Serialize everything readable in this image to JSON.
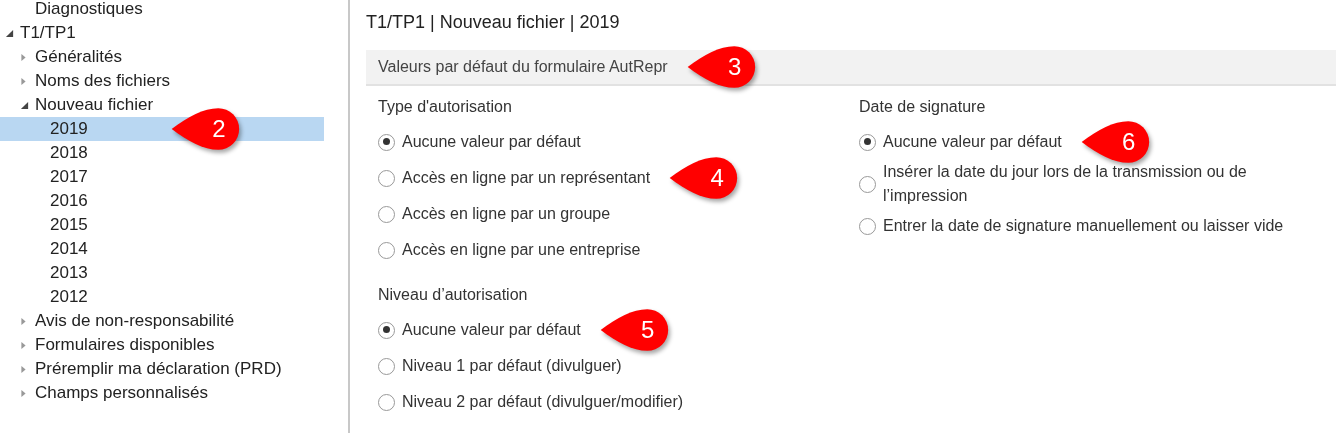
{
  "tree": {
    "clipped_above": [
      {
        "label": "Diagnostiques",
        "selected": false
      }
    ],
    "items": [
      {
        "label": "T1/TP1",
        "expanded": true,
        "selected": false,
        "children": [
          {
            "label": "Généralités",
            "expanded": false,
            "selected": false
          },
          {
            "label": "Noms des fichiers",
            "expanded": false,
            "selected": false
          },
          {
            "label": "Nouveau fichier",
            "expanded": true,
            "selected": false,
            "children": [
              {
                "label": "2019",
                "selected": true,
                "callout": "2"
              },
              {
                "label": "2018",
                "selected": false
              },
              {
                "label": "2017",
                "selected": false
              },
              {
                "label": "2016",
                "selected": false
              },
              {
                "label": "2015",
                "selected": false
              },
              {
                "label": "2014",
                "selected": false
              },
              {
                "label": "2013",
                "selected": false
              },
              {
                "label": "2012",
                "selected": false
              }
            ]
          },
          {
            "label": "Avis de non-responsabilité",
            "expanded": false,
            "selected": false
          },
          {
            "label": "Formulaires disponibles",
            "expanded": false,
            "selected": false
          },
          {
            "label": "Préremplir ma déclaration (PRD)",
            "expanded": false,
            "selected": false
          },
          {
            "label": "Champs personnalisés",
            "expanded": false,
            "selected": false
          }
        ]
      }
    ]
  },
  "page": {
    "breadcrumb": "T1/TP1 | Nouveau fichier | 2019",
    "section": {
      "title": "Valeurs par défaut du formulaire AutRepr",
      "callout": "3"
    },
    "columns": [
      [
        {
          "title": "Type d'autorisation",
          "options": [
            {
              "label": "Aucune valeur par défaut",
              "selected": true
            },
            {
              "label": "Accès en ligne par un représentant",
              "selected": false,
              "callout": "4"
            },
            {
              "label": "Accès en ligne par un groupe",
              "selected": false
            },
            {
              "label": "Accès en ligne par une entreprise",
              "selected": false
            }
          ]
        },
        {
          "title": "Niveau d’autorisation",
          "options": [
            {
              "label": "Aucune valeur par défaut",
              "selected": true,
              "callout": "5"
            },
            {
              "label": "Niveau 1 par défaut (divulguer)",
              "selected": false
            },
            {
              "label": "Niveau 2 par défaut (divulguer/modifier)",
              "selected": false
            }
          ]
        }
      ],
      [
        {
          "title": "Date de signature",
          "options": [
            {
              "label": "Aucune valeur par défaut",
              "selected": true,
              "callout": "6"
            },
            {
              "label": "Insérer la date du jour lors de la transmission ou de l’impression",
              "selected": false
            },
            {
              "label": "Entrer la date de signature manuellement ou laisser vide",
              "selected": false
            }
          ]
        }
      ]
    ]
  }
}
